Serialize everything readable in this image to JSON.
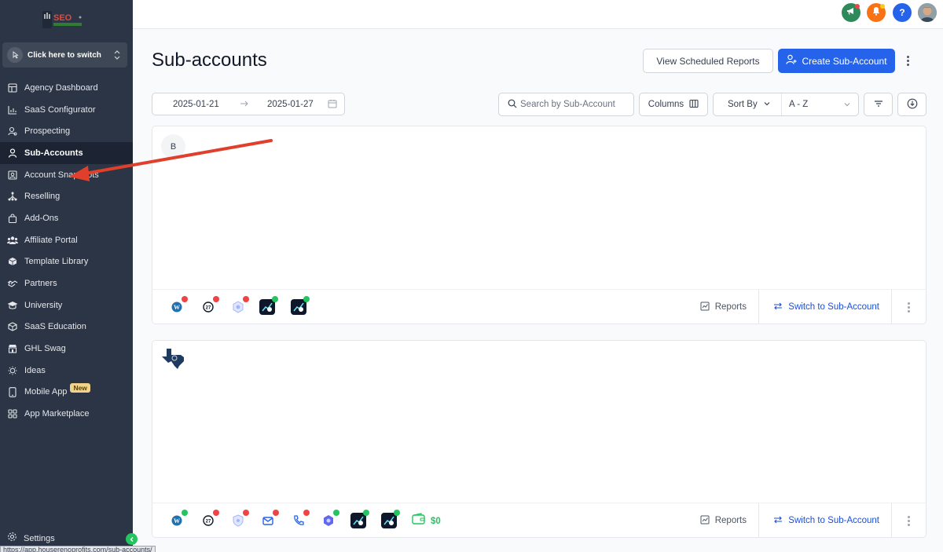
{
  "sidebar": {
    "logo_text": "SEO",
    "switcher_label": "Click here to switch",
    "items": [
      {
        "label": "Agency Dashboard",
        "icon": "dashboard-icon"
      },
      {
        "label": "SaaS Configurator",
        "icon": "chart-icon"
      },
      {
        "label": "Prospecting",
        "icon": "prospect-icon"
      },
      {
        "label": "Sub-Accounts",
        "icon": "user-icon",
        "active": true
      },
      {
        "label": "Account Snapshots",
        "icon": "snapshot-icon"
      },
      {
        "label": "Reselling",
        "icon": "hierarchy-icon"
      },
      {
        "label": "Add-Ons",
        "icon": "bag-icon"
      },
      {
        "label": "Affiliate Portal",
        "icon": "users-icon"
      },
      {
        "label": "Template Library",
        "icon": "cube-icon"
      },
      {
        "label": "Partners",
        "icon": "handshake-icon"
      },
      {
        "label": "University",
        "icon": "graduation-icon"
      },
      {
        "label": "SaaS Education",
        "icon": "box-icon"
      },
      {
        "label": "GHL Swag",
        "icon": "store-icon"
      },
      {
        "label": "Ideas",
        "icon": "lightbulb-icon"
      },
      {
        "label": "Mobile App",
        "icon": "phone-icon",
        "badge": "New"
      },
      {
        "label": "App Marketplace",
        "icon": "grid-icon"
      }
    ],
    "settings_label": "Settings"
  },
  "status_url": "https://app.houserenoprofits.com/sub-accounts/",
  "header": {
    "title": "Sub-accounts",
    "view_reports_label": "View Scheduled Reports",
    "create_label": "Create Sub-Account"
  },
  "filters": {
    "date_from": "2025-01-21",
    "date_to": "2025-01-27",
    "search_placeholder": "Search by Sub-Account",
    "columns_label": "Columns",
    "sort_label": "Sort By",
    "sort_value": "A - Z"
  },
  "cards": [
    {
      "avatar_text": "B",
      "reports_label": "Reports",
      "switch_label": "Switch to Sub-Account"
    },
    {
      "reports_label": "Reports",
      "switch_label": "Switch to Sub-Account",
      "wallet_amount": "$0"
    }
  ],
  "colors": {
    "sidebar_bg": "#2b3545",
    "active_bg": "#1c2433",
    "primary": "#2563eb",
    "annotation_arrow": "#e0402b"
  }
}
